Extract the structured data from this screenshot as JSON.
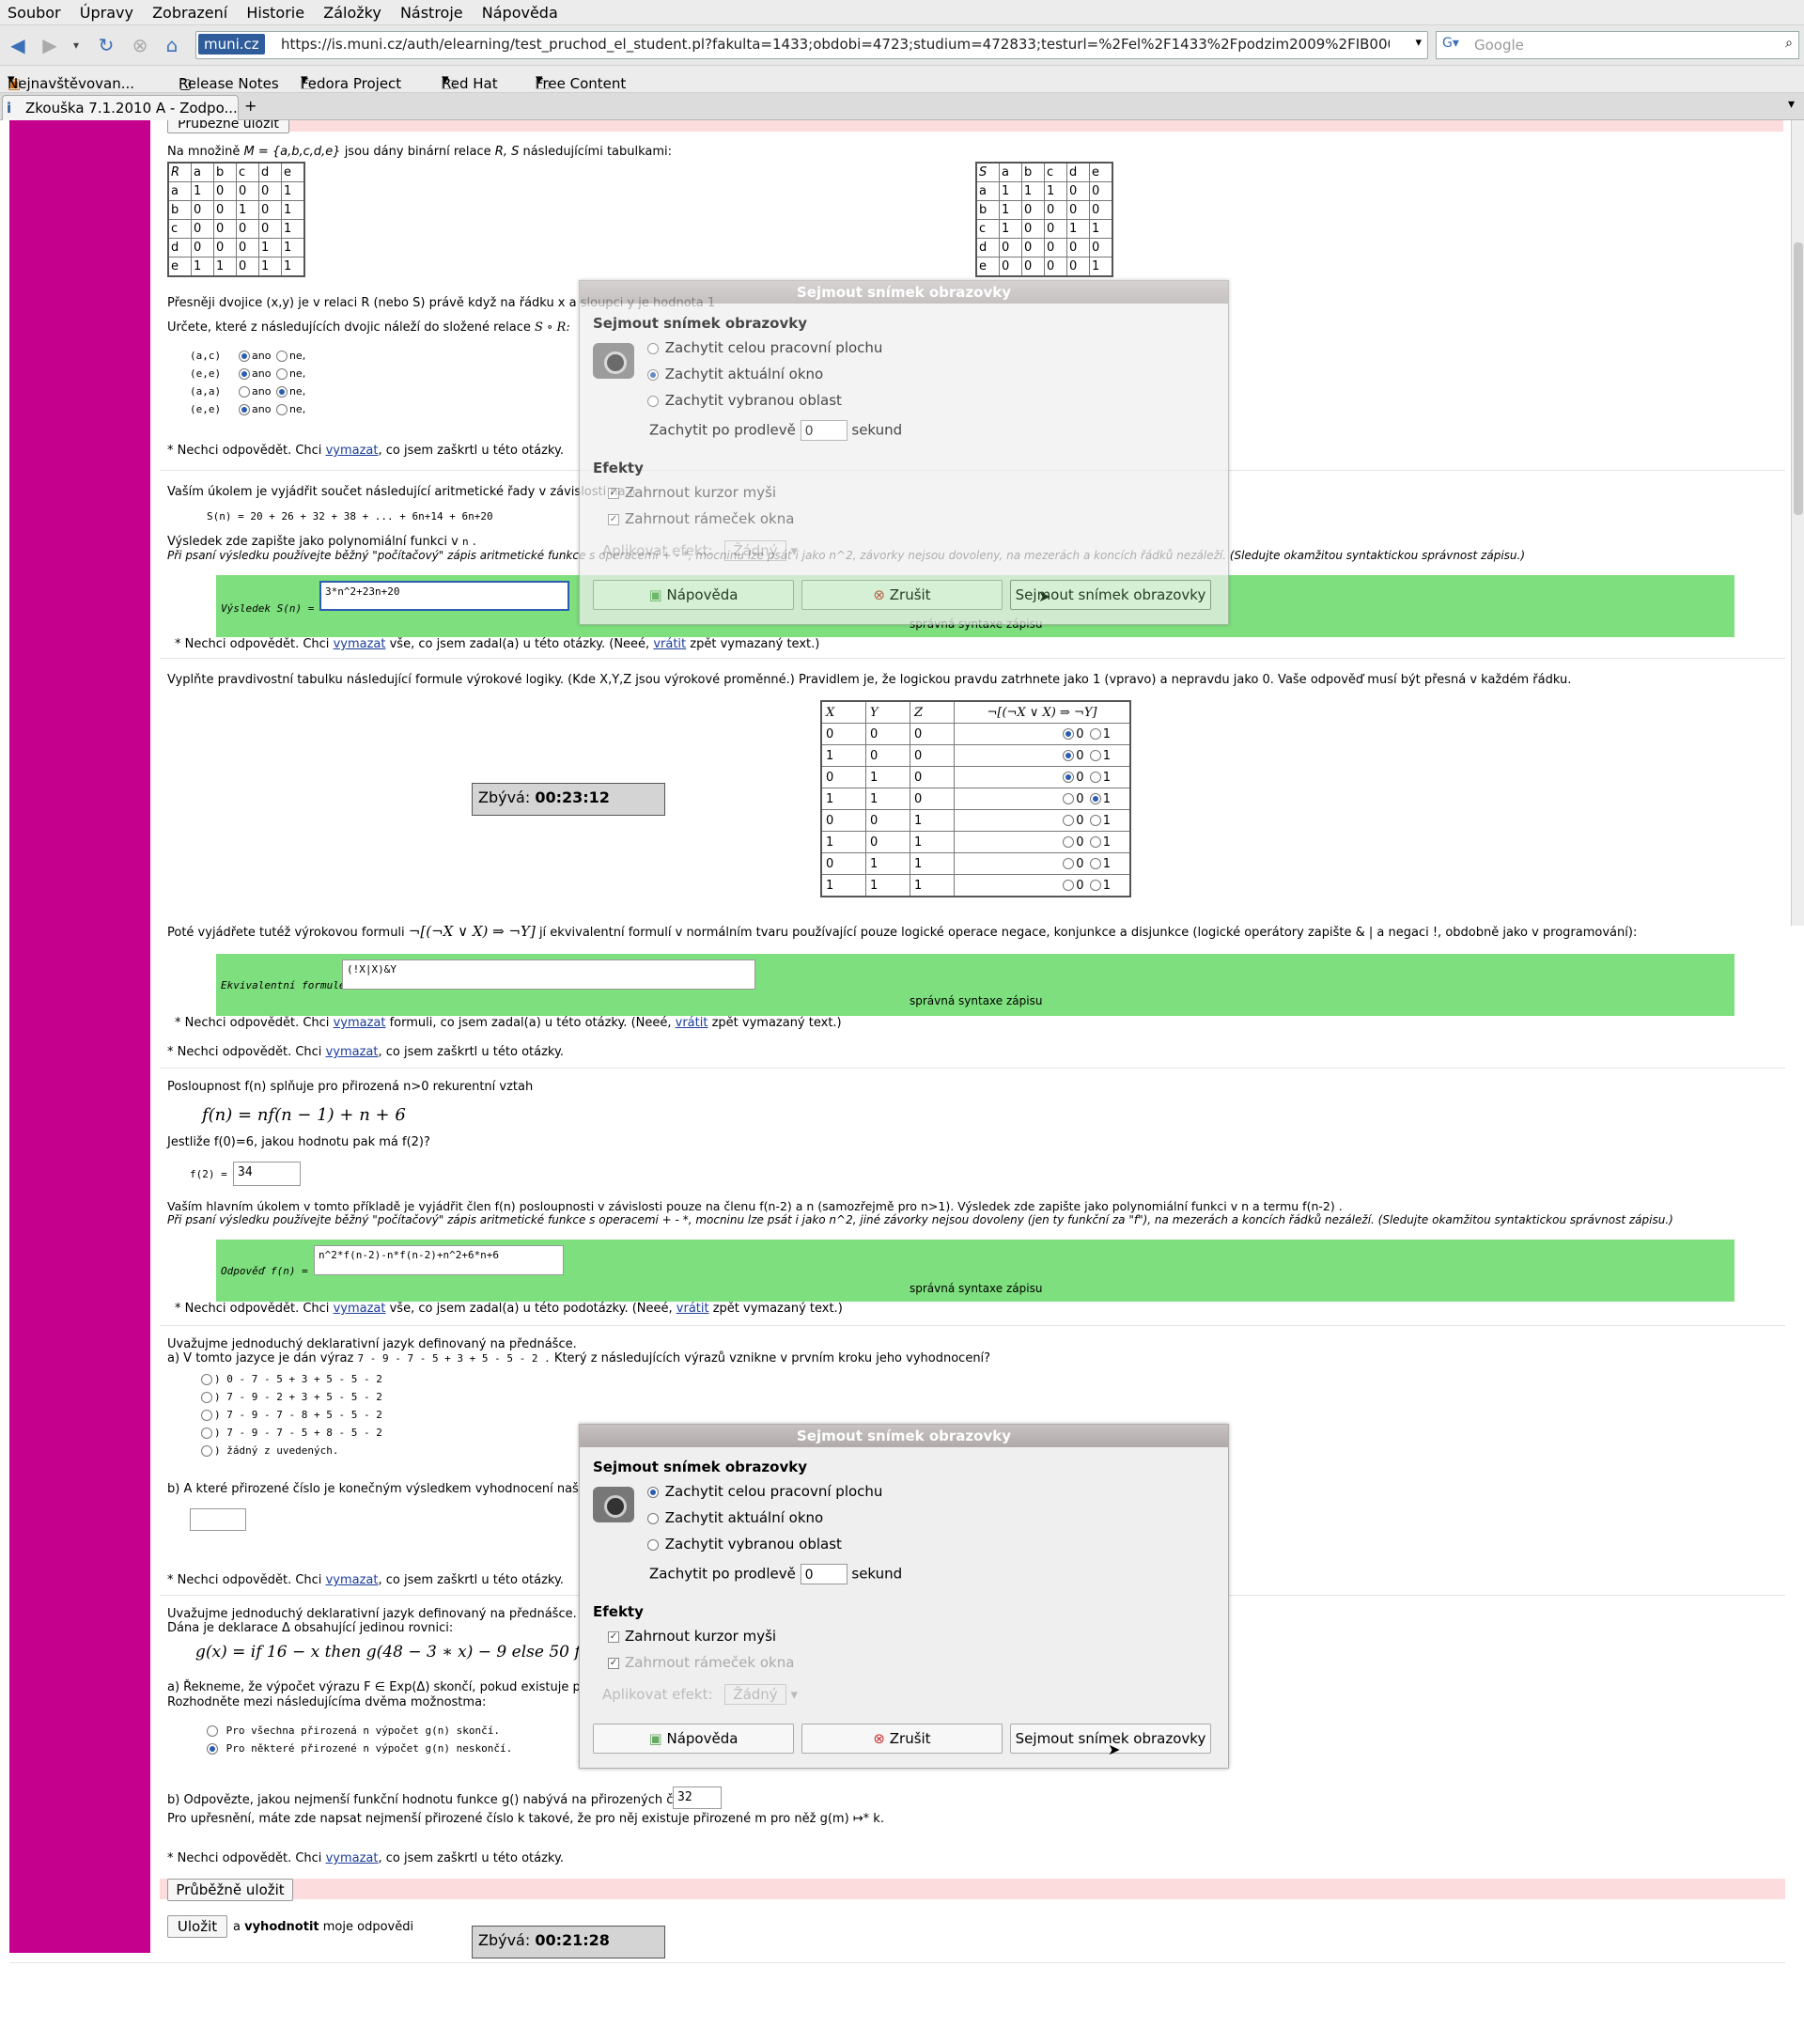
{
  "menu": [
    "Soubor",
    "Úpravy",
    "Zobrazení",
    "Historie",
    "Záložky",
    "Nástroje",
    "Nápověda"
  ],
  "nav": {
    "site_badge": "muni.cz",
    "url": "https://is.muni.cz/auth/elearning/test_pruchod_el_student.pl?fakulta=1433;obdobi=4723;studium=472833;testurl=%2Fel%2F1433%2Fpodzim2009%2FIB000%2Foc",
    "search_placeholder": "Google"
  },
  "bookmarks": [
    "Nejnavštěvovan...",
    "Release Notes",
    "Fedora Project",
    "Red Hat",
    "Free Content"
  ],
  "tab": {
    "title": "Zkouška 7.1.2010 A - Zodpo..."
  },
  "page": {
    "top_save": "Průběžně uložit",
    "q1": {
      "intro_a": "Na množině ",
      "intro_set": "M = {a,b,c,d,e}",
      "intro_b": " jsou dány binární relace ",
      "intro_rs": "R, S",
      "intro_c": " následujícími tabulkami:",
      "R_header": [
        "R",
        "a",
        "b",
        "c",
        "d",
        "e"
      ],
      "R_rows": [
        [
          "a",
          "1",
          "0",
          "0",
          "0",
          "1"
        ],
        [
          "b",
          "0",
          "0",
          "1",
          "0",
          "1"
        ],
        [
          "c",
          "0",
          "0",
          "0",
          "0",
          "1"
        ],
        [
          "d",
          "0",
          "0",
          "0",
          "1",
          "1"
        ],
        [
          "e",
          "1",
          "1",
          "0",
          "1",
          "1"
        ]
      ],
      "S_header": [
        "S",
        "a",
        "b",
        "c",
        "d",
        "e"
      ],
      "S_rows": [
        [
          "a",
          "1",
          "1",
          "1",
          "0",
          "0"
        ],
        [
          "b",
          "1",
          "0",
          "0",
          "0",
          "0"
        ],
        [
          "c",
          "1",
          "0",
          "0",
          "1",
          "1"
        ],
        [
          "d",
          "0",
          "0",
          "0",
          "0",
          "0"
        ],
        [
          "e",
          "0",
          "0",
          "0",
          "0",
          "1"
        ]
      ],
      "precise": "Přesněji dvojice (x,y) je v relaci R (nebo S) právě když na řádku x a sloupci y je hodnota 1",
      "task": "Určete, které z následujících dvojic náleží do složené relace",
      "task_math": "S ∘ R:",
      "pairs": [
        {
          "label": "(a,c)",
          "yes": "ano",
          "no": "ne,",
          "sel": "yes"
        },
        {
          "label": "(e,e)",
          "yes": "ano",
          "no": "ne,",
          "sel": "yes"
        },
        {
          "label": "(a,a)",
          "yes": "ano",
          "no": "ne,",
          "sel": "no"
        },
        {
          "label": "(e,e)",
          "yes": "ano",
          "no": "ne,",
          "sel": "yes"
        }
      ],
      "no_answer_pre": "* Nechci odpovědět. Chci ",
      "no_answer_link": "vymazat",
      "no_answer_post": ", co jsem zaškrtl u této otázky."
    },
    "q2": {
      "intro": "Vaším úkolem je vyjádřit součet následující aritmetické řady v závislosti na",
      "series": "S(n)  =  20 + 26 + 32 + 38 + ... + 6n+14 + 6n+20",
      "result_line": "Výsledek zde zapište jako polynomiální funkci v",
      "hint": "Při psaní výsledku používejte běžný \"počítačový\" zápis aritmetické funkce s operacemi + - *, mocninu lze psát i jako n^2, závorky nejsou dovoleny, na mezerách a koncích řádků nezáleží. (Sledujte okamžitou syntaktickou správnost zápisu.)",
      "label": "Výsledek  S(n) =",
      "value": "3*n^2+23n+20",
      "syntax": "správná syntaxe zápisu",
      "no_answer_pre": "* Nechci odpovědět. Chci ",
      "no_answer_link": "vymazat",
      "no_answer_mid": " vše, co jsem zadal(a) u této otázky. (Neeé, ",
      "no_answer_link2": "vrátit",
      "no_answer_post": " zpět vymazaný text.)"
    },
    "q3": {
      "intro": "Vyplňte pravdivostní tabulku následující formule výrokové logiky. (Kde X,Y,Z jsou výrokové proměnné.) Pravidlem je, že logickou pravdu zatrhnete jako 1 (vpravo) a nepravdu jako 0. Vaše odpověď musí být přesná v každém řádku.",
      "headers": [
        "X",
        "Y",
        "Z",
        "¬[(¬X ∨ X) ⇒ ¬Y]"
      ],
      "rows": [
        {
          "x": "0",
          "y": "0",
          "z": "0",
          "sel": "0"
        },
        {
          "x": "1",
          "y": "0",
          "z": "0",
          "sel": "0"
        },
        {
          "x": "0",
          "y": "1",
          "z": "0",
          "sel": "0"
        },
        {
          "x": "1",
          "y": "1",
          "z": "0",
          "sel": "1"
        },
        {
          "x": "0",
          "y": "0",
          "z": "1",
          "sel": ""
        },
        {
          "x": "1",
          "y": "0",
          "z": "1",
          "sel": ""
        },
        {
          "x": "0",
          "y": "1",
          "z": "1",
          "sel": ""
        },
        {
          "x": "1",
          "y": "1",
          "z": "1",
          "sel": ""
        }
      ],
      "zero": "0",
      "one": "1",
      "timer_label": "Zbývá:",
      "timer_value": "00:23:12",
      "then_a": "Poté vyjádřete tutéž výrokovou formuli",
      "then_formula": "¬[(¬X ∨ X) ⇒ ¬Y]",
      "then_b": "jí ekvivalentní formulí v normálním tvaru používající pouze logické operace negace, konjunkce a disjunkce (logické operátory zapište & | a negaci !, obdobně jako v programování):",
      "eq_label": "Ekvivalentní formule",
      "eq_value": "(!X|X)&Y",
      "syntax": "správná syntaxe zápisu",
      "no_answer_a_pre": "* Nechci odpovědět. Chci ",
      "no_answer_a_link": "vymazat",
      "no_answer_a_mid": " formuli, co jsem zadal(a) u této otázky. (Neeé, ",
      "no_answer_a_link2": "vrátit",
      "no_answer_a_post": " zpět vymazaný text.)",
      "no_answer_b_pre": "* Nechci odpovědět. Chci ",
      "no_answer_b_link": "vymazat",
      "no_answer_b_post": ", co jsem zaškrtl u této otázky."
    },
    "q4": {
      "intro": "Posloupnost f(n) splňuje pro přirozená n>0 rekurentní vztah",
      "formula": "f(n)  =  nf(n − 1) + n + 6",
      "ask": "Jestliže f(0)=6, jakou hodnotu pak má f(2)?",
      "f2_label": "f(2) =",
      "f2_value": "34",
      "main_a": "Vaším hlavním úkolem v tomto příkladě je vyjádřit člen f(n) posloupnosti v závislosti pouze na členu f(n-2) a n (samozřejmě pro n>1). Výsledek zde zapište jako polynomiální funkci v  n  a termu  f(n-2) .",
      "hint": "Při psaní výsledku používejte běžný \"počítačový\" zápis aritmetické funkce s operacemi + - *, mocninu lze psát i jako n^2, jiné závorky nejsou dovoleny (jen ty funkční za \"f\"), na mezerách a koncích řádků nezáleží. (Sledujte okamžitou syntaktickou správnost zápisu.)",
      "ans_label": "Odpověď  f(n) =",
      "ans_value": "n^2*f(n-2)-n*f(n-2)+n^2+6*n+6",
      "syntax": "správná syntaxe zápisu",
      "no_answer_pre": "* Nechci odpovědět. Chci ",
      "no_answer_link": "vymazat",
      "no_answer_mid": " vše, co jsem zadal(a) u této podotázky. (Neeé, ",
      "no_answer_link2": "vrátit",
      "no_answer_post": " zpět vymazaný text.)"
    },
    "q5": {
      "intro": "Uvažujme jednoduchý deklarativní jazyk definovaný na přednášce.",
      "a_pre": "a)  V tomto jazyce je dán výraz",
      "a_expr": "7 - 9 - 7 - 5 + 3 + 5 - 5 - 2 .",
      "a_post": "Který z následujících výrazů vznikne v prvním kroku jeho vyhodnocení?",
      "options": [
        "0 - 7 - 5 + 3 + 5 - 5 - 2",
        "7 - 9 - 2 + 3 + 5 - 5 - 2",
        "7 - 9 - 7 - 8 + 5 - 5 - 2",
        "7 - 9 - 7 - 5 + 8 - 5 - 2",
        "žádný z uvedených."
      ],
      "b_text": "b)  A které přirozené číslo je konečným výsledkem vyhodnocení našeho",
      "no_answer_pre": "* Nechci odpovědět. Chci ",
      "no_answer_link": "vymazat",
      "no_answer_post": ", co jsem zaškrtl u této otázky."
    },
    "q6": {
      "intro": "Uvažujme jednoduchý deklarativní jazyk definovaný na přednášce.",
      "decl": "Dána je deklarace Δ obsahující jedinou rovnici:",
      "formula": "g(x) =  if 16 − x then g(48 − 3 ∗ x) − 9 else 50 fi",
      "a_text": "a) Řekneme, že výpočet výrazu F ∈ Exp(Δ) skončí, pokud existuje přirozené číslo",
      "a_text2": "Rozhodněte mezi následujícíma dvěma možnostma:",
      "opt1": "Pro všechna přirozená n výpočet g(n) skončí.",
      "opt2": "Pro některé přirozené n výpočet g(n) neskončí.",
      "b_text": "b) Odpovězte, jakou nejmenší funkční hodnotu funkce g() nabývá na přirozených číslech:",
      "b_value": "32",
      "b_text2": "Pro upřesnění, máte zde napsat nejmenší přirozené číslo k takové, že pro něj existuje přirozené m pro něž g(m) ↦* k.",
      "no_answer_pre": "* Nechci odpovědět. Chci ",
      "no_answer_link": "vymazat",
      "no_answer_post": ", co jsem zaškrtl u této otázky."
    },
    "bottom_save": "Průběžně uložit",
    "submit": "Uložit",
    "submit_after_a": "a ",
    "submit_after_b": "vyhodnotit",
    "submit_after_c": " moje odpovědi",
    "timer_label": "Zbývá:",
    "timer_value": "00:21:28"
  },
  "dialog": {
    "title": "Sejmout snímek obrazovky",
    "heading": "Sejmout snímek obrazovky",
    "opt_desktop": "Zachytit celou pracovní plochu",
    "opt_window": "Zachytit aktuální okno",
    "opt_area": "Zachytit vybranou oblast",
    "delay_pre": "Zachytit po prodlevě",
    "delay_value": "0",
    "delay_post": "sekund",
    "effects": "Efekty",
    "cursor": "Zahrnout kurzor myši",
    "border": "Zahrnout rámeček okna",
    "apply": "Aplikovat efekt:",
    "apply_value": "Žádný",
    "help": "Nápověda",
    "cancel": "Zrušit",
    "take": "Sejmout snímek obrazovky"
  }
}
